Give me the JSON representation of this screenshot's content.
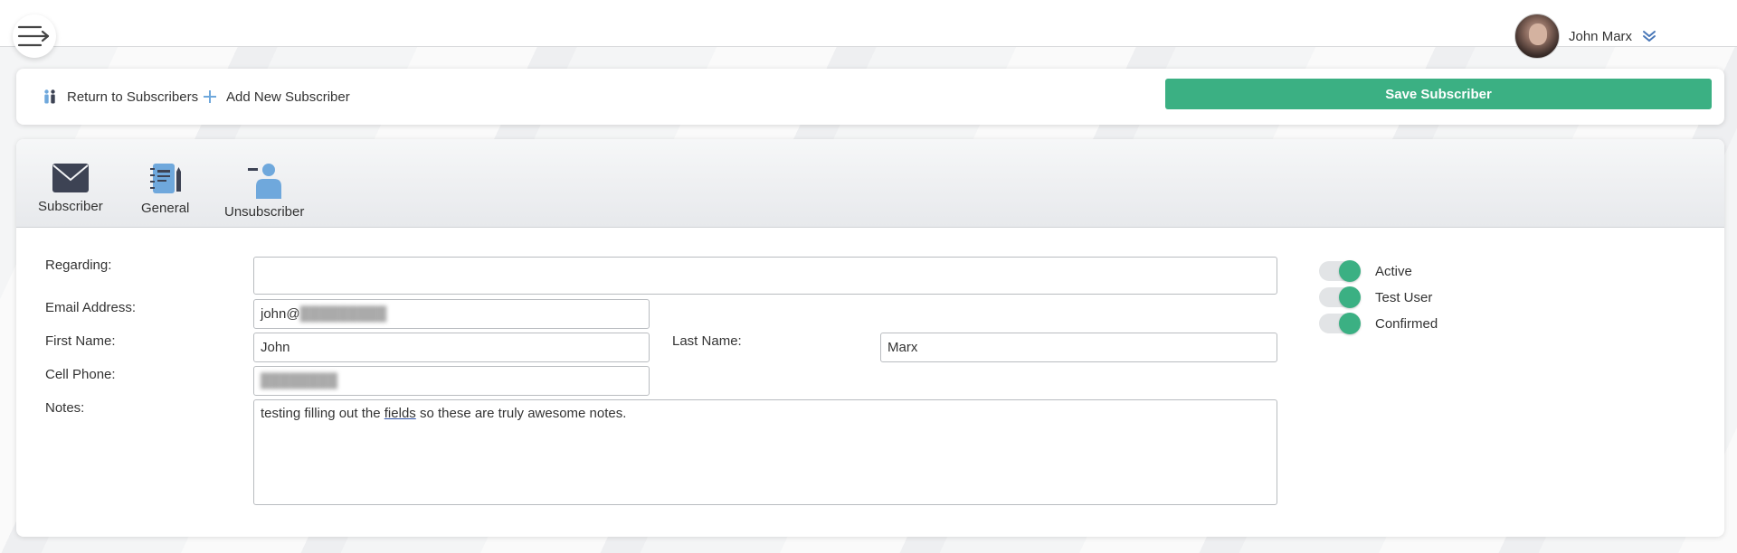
{
  "header": {
    "menu_icon": "menu-arrow-icon",
    "user_name": "John Marx"
  },
  "actions": {
    "return_label": "Return to Subscribers",
    "add_label": "Add New Subscriber",
    "save_label": "Save Subscriber"
  },
  "tabs": [
    {
      "label": "Subscriber",
      "icon": "envelope-icon"
    },
    {
      "label": "General",
      "icon": "notebook-icon"
    },
    {
      "label": "Unsubscriber",
      "icon": "user-remove-icon"
    }
  ],
  "form": {
    "regarding_label": "Regarding:",
    "regarding_value": "",
    "email_label": "Email Address:",
    "email_value": "john@",
    "first_name_label": "First Name:",
    "first_name_value": "John",
    "last_name_label": "Last Name:",
    "last_name_value": "Marx",
    "cell_label": "Cell Phone:",
    "cell_value": "",
    "notes_label": "Notes:",
    "notes_before": "testing filling out the ",
    "notes_link": "fields",
    "notes_after": " so these are truly awesome notes."
  },
  "toggles": [
    {
      "label": "Active",
      "on": true
    },
    {
      "label": "Test User",
      "on": true
    },
    {
      "label": "Confirmed",
      "on": true
    }
  ],
  "colors": {
    "accent": "#3bb083",
    "icon_blue": "#6fa8dc",
    "icon_dark": "#3d4354"
  }
}
